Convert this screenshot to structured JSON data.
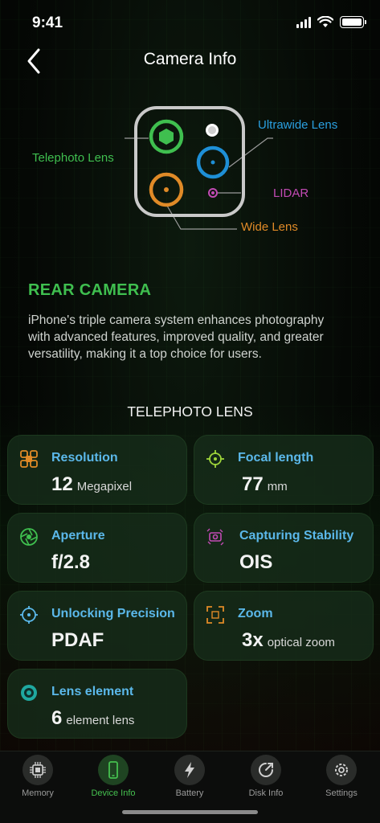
{
  "status_bar": {
    "time": "9:41"
  },
  "nav": {
    "title": "Camera Info"
  },
  "diagram": {
    "labels": {
      "telephoto": "Telephoto Lens",
      "ultrawide": "Ultrawide Lens",
      "lidar": "LIDAR",
      "wide": "Wide Lens"
    }
  },
  "section": {
    "title": "REAR CAMERA",
    "description": "iPhone's triple camera system enhances photography with advanced features, improved quality, and greater versatility, making it a top choice for users."
  },
  "lens_heading": "TELEPHOTO LENS",
  "cards": [
    {
      "title": "Resolution",
      "value": "12",
      "unit": "Megapixel",
      "icon": "chip-grid-icon"
    },
    {
      "title": "Focal length",
      "value": "77",
      "unit": "mm",
      "icon": "crosshair-icon"
    },
    {
      "title": "Aperture",
      "value": "f/2.8",
      "unit": "",
      "icon": "aperture-icon"
    },
    {
      "title": "Capturing Stability",
      "value": "OIS",
      "unit": "",
      "icon": "stabilization-icon"
    },
    {
      "title": "Unlocking Precision",
      "value": "PDAF",
      "unit": "",
      "icon": "target-icon"
    },
    {
      "title": "Zoom",
      "value": "3x",
      "unit": "optical zoom",
      "icon": "zoom-frame-icon"
    },
    {
      "title": "Lens element",
      "value": "6",
      "unit": "element lens",
      "icon": "lens-icon"
    }
  ],
  "tabs": [
    {
      "label": "Memory",
      "icon": "memory-chip-icon"
    },
    {
      "label": "Device Info",
      "icon": "phone-icon",
      "active": true
    },
    {
      "label": "Battery",
      "icon": "bolt-icon"
    },
    {
      "label": "Disk Info",
      "icon": "disk-icon"
    },
    {
      "label": "Settings",
      "icon": "gear-icon"
    }
  ],
  "colors": {
    "accent_green": "#3fbf4f",
    "accent_blue": "#5bb8ea",
    "ultrawide_blue": "#1e8fd6",
    "wide_orange": "#e08a27",
    "lidar_magenta": "#c24ab4"
  }
}
